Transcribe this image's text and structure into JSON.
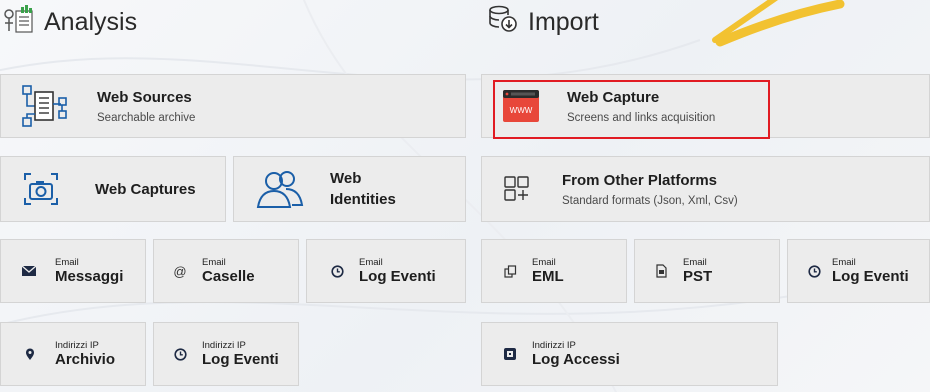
{
  "analysis": {
    "title": "Analysis",
    "web_sources": {
      "title": "Web Sources",
      "subtitle": "Searchable archive"
    },
    "web_captures": {
      "title": "Web Captures"
    },
    "web_identities": {
      "title_line1": "Web",
      "title_line2": "Identities"
    },
    "email_messages": {
      "caption": "Email",
      "label": "Messaggi"
    },
    "email_mailboxes": {
      "caption": "Email",
      "label": "Caselle"
    },
    "email_log": {
      "caption": "Email",
      "label": "Log Eventi"
    },
    "ip_archive": {
      "caption": "Indirizzi IP",
      "label": "Archivio"
    },
    "ip_log": {
      "caption": "Indirizzi IP",
      "label": "Log Eventi"
    }
  },
  "import": {
    "title": "Import",
    "web_capture": {
      "title": "Web Capture",
      "subtitle": "Screens and links acquisition",
      "icon_text": "WWW"
    },
    "other_platforms": {
      "title": "From Other Platforms",
      "subtitle": "Standard formats (Json, Xml, Csv)"
    },
    "email_eml": {
      "caption": "Email",
      "label": "EML"
    },
    "email_pst": {
      "caption": "Email",
      "label": "PST"
    },
    "email_log": {
      "caption": "Email",
      "label": "Log Eventi"
    },
    "ip_access_log": {
      "caption": "Indirizzi IP",
      "label": "Log Accessi"
    }
  },
  "colors": {
    "highlight": "#e11b22",
    "accent_yellow": "#f2c231",
    "www_icon": "#e8473a"
  }
}
